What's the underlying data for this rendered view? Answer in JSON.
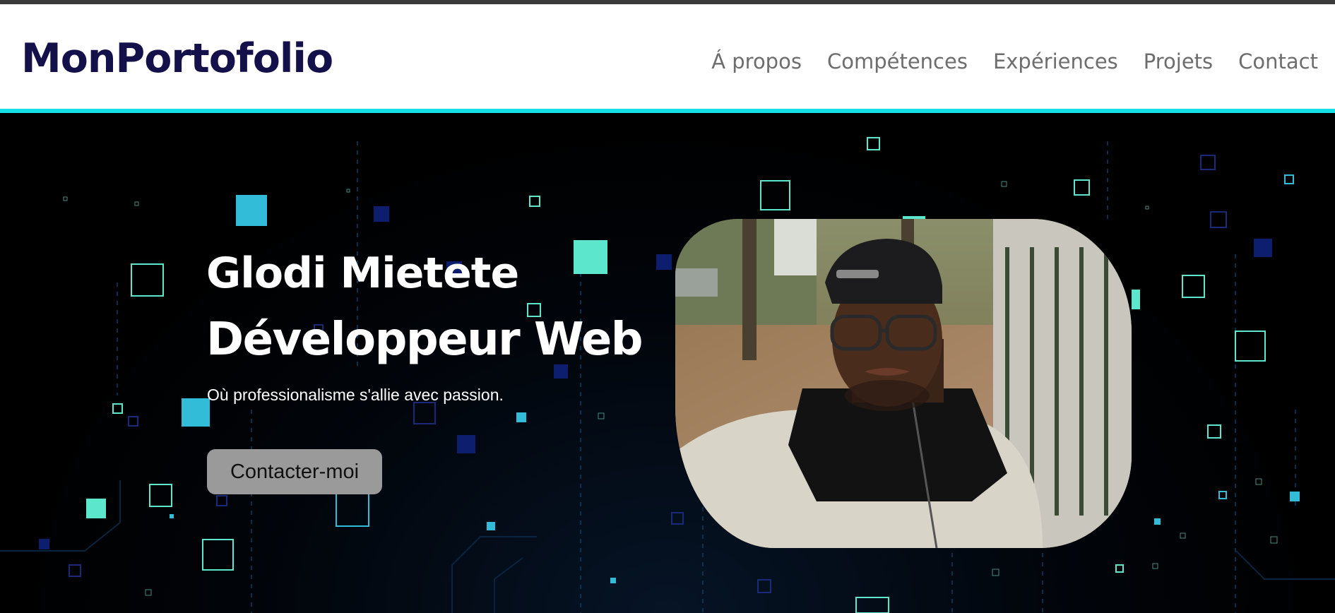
{
  "header": {
    "logo": "MonPortofolio",
    "nav": [
      "Á propos",
      "Compétences",
      "Expériences",
      "Projets",
      "Contact"
    ]
  },
  "hero": {
    "name": "Glodi Mietete",
    "role": "Développeur Web",
    "tagline": "Où professionalisme s'allie avec passion.",
    "cta_label": "Contacter-moi"
  },
  "colors": {
    "brand": "#14104a",
    "accent_line": "#14e0e6",
    "square_cyan": "#32bcd8",
    "square_mint": "#5ce6cc",
    "square_navy": "#0e1e6e"
  },
  "icons": {
    "portrait": "profile-photo"
  }
}
